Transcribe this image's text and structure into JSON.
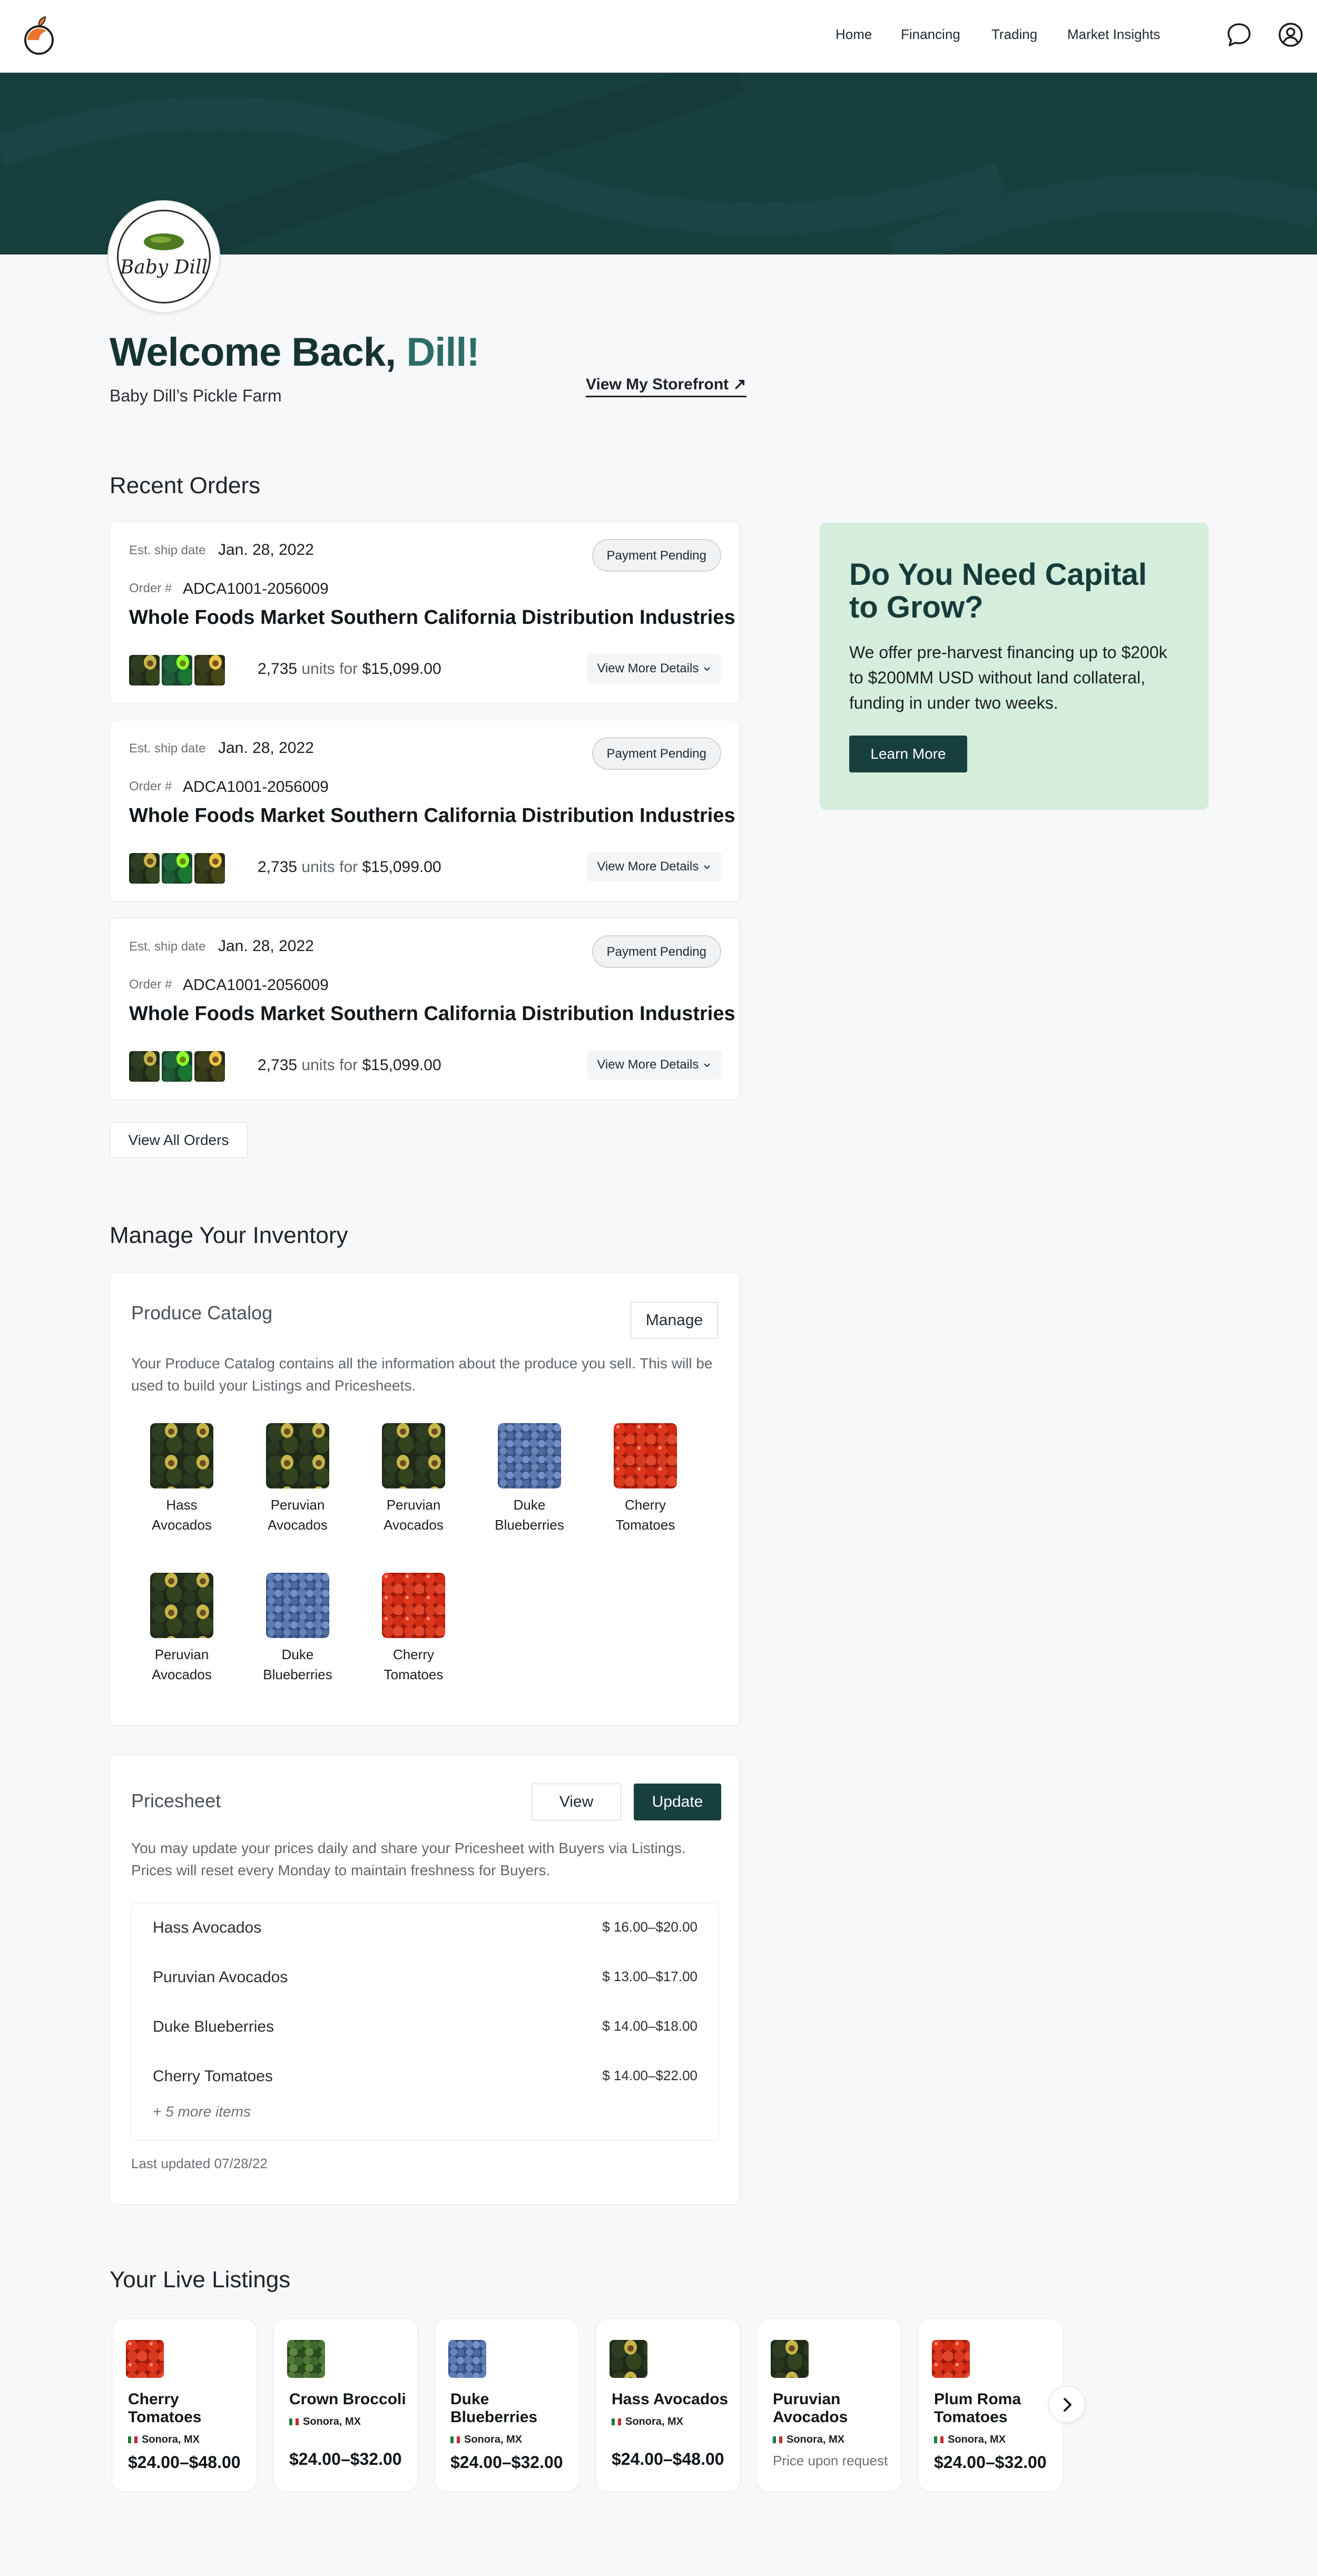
{
  "nav": {
    "items": [
      "Home",
      "Financing",
      "Trading",
      "Market Insights"
    ]
  },
  "profile": {
    "logo_text": "Baby Dill",
    "welcome_prefix": "Welcome Back, ",
    "welcome_name": "Dill!",
    "farm_name": "Baby Dill’s Pickle Farm",
    "storefront_link": "View My Storefront ↗"
  },
  "recent_orders": {
    "title": "Recent Orders",
    "orders": [
      {
        "ship_label": "Est. ship date",
        "ship_date": "Jan. 28, 2022",
        "status": "Payment Pending",
        "order_label": "Order #",
        "order_number": "ADCA1001-2056009",
        "buyer": "Whole Foods Market Southern California Distribution Industries",
        "units": "2,735",
        "units_for": "units for",
        "total": "$15,099.00",
        "details": "View More Details"
      },
      {
        "ship_label": "Est. ship date",
        "ship_date": "Jan. 28, 2022",
        "status": "Payment Pending",
        "order_label": "Order #",
        "order_number": "ADCA1001-2056009",
        "buyer": "Whole Foods Market Southern California Distribution Industries",
        "units": "2,735",
        "units_for": "units for",
        "total": "$15,099.00",
        "details": "View More Details"
      },
      {
        "ship_label": "Est. ship date",
        "ship_date": "Jan. 28, 2022",
        "status": "Payment Pending",
        "order_label": "Order #",
        "order_number": "ADCA1001-2056009",
        "buyer": "Whole Foods Market Southern California Distribution Industries",
        "units": "2,735",
        "units_for": "units for",
        "total": "$15,099.00",
        "details": "View More Details"
      }
    ],
    "view_all": "View All Orders"
  },
  "capital": {
    "title": "Do You Need Capital to Grow?",
    "body": "We offer pre-harvest financing up to $200k to $200MM USD without land collateral, funding in under two weeks.",
    "button": "Learn More"
  },
  "inventory": {
    "title": "Manage Your Inventory",
    "catalog": {
      "title": "Produce Catalog",
      "manage_button": "Manage",
      "description": "Your Produce Catalog contains all the information about the produce you sell. This will be used to build your Listings and Pricesheets.",
      "items": [
        {
          "label": "Hass Avocados",
          "kind": "avocado"
        },
        {
          "label": "Peruvian Avocados",
          "kind": "avocado"
        },
        {
          "label": "Peruvian Avocados",
          "kind": "avocado"
        },
        {
          "label": "Duke Blueberries",
          "kind": "blueberry"
        },
        {
          "label": "Cherry Tomatoes",
          "kind": "tomato"
        },
        {
          "label": "Peruvian Avocados",
          "kind": "avocado"
        },
        {
          "label": "Duke Blueberries",
          "kind": "blueberry"
        },
        {
          "label": "Cherry Tomatoes",
          "kind": "tomato"
        }
      ]
    },
    "pricesheet": {
      "title": "Pricesheet",
      "view_button": "View",
      "update_button": "Update",
      "description": "You may update your prices daily and share your Pricesheet with Buyers via Listings. Prices will reset every Monday to maintain freshness for Buyers.",
      "rows": [
        {
          "name": "Hass Avocados",
          "price": "$ 16.00–$20.00"
        },
        {
          "name": "Puruvian Avocados",
          "price": "$ 13.00–$17.00"
        },
        {
          "name": "Duke Blueberries",
          "price": "$ 14.00–$18.00"
        },
        {
          "name": "Cherry Tomatoes",
          "price": "$ 14.00–$22.00"
        }
      ],
      "more_items": "+ 5 more items",
      "last_updated": "Last updated 07/28/22"
    }
  },
  "listings": {
    "title": "Your Live Listings",
    "items": [
      {
        "name": "Cherry Tomatoes",
        "origin": "Sonora, MX",
        "price": "$24.00–$48.00",
        "kind": "tomato"
      },
      {
        "name": "Crown Broccoli",
        "origin": "Sonora, MX",
        "price": "$24.00–$32.00",
        "kind": "broccoli"
      },
      {
        "name": "Duke Blueberries",
        "origin": "Sonora, MX",
        "price": "$24.00–$32.00",
        "kind": "blueberry"
      },
      {
        "name": "Hass Avocados",
        "origin": "Sonora, MX",
        "price": "$24.00–$48.00",
        "kind": "avocado"
      },
      {
        "name": "Puruvian Avocados",
        "origin": "Sonora, MX",
        "price": "Price upon request",
        "kind": "avocado"
      },
      {
        "name": "Plum Roma Tomatoes",
        "origin": "Sonora, MX",
        "price": "$24.00–$32.00",
        "kind": "tomato"
      }
    ]
  },
  "colors": {
    "brand_dark": "#173f3e",
    "brand_accent": "#2c6e67",
    "capital_bg": "#d4eddd",
    "logo_orange": "#e8762c"
  },
  "icons": [
    "orange-logo-icon",
    "chat-bubble-icon",
    "user-profile-icon",
    "arrow-up-right-icon",
    "chevron-down-icon",
    "chevron-right-icon",
    "mexico-flag-icon"
  ]
}
